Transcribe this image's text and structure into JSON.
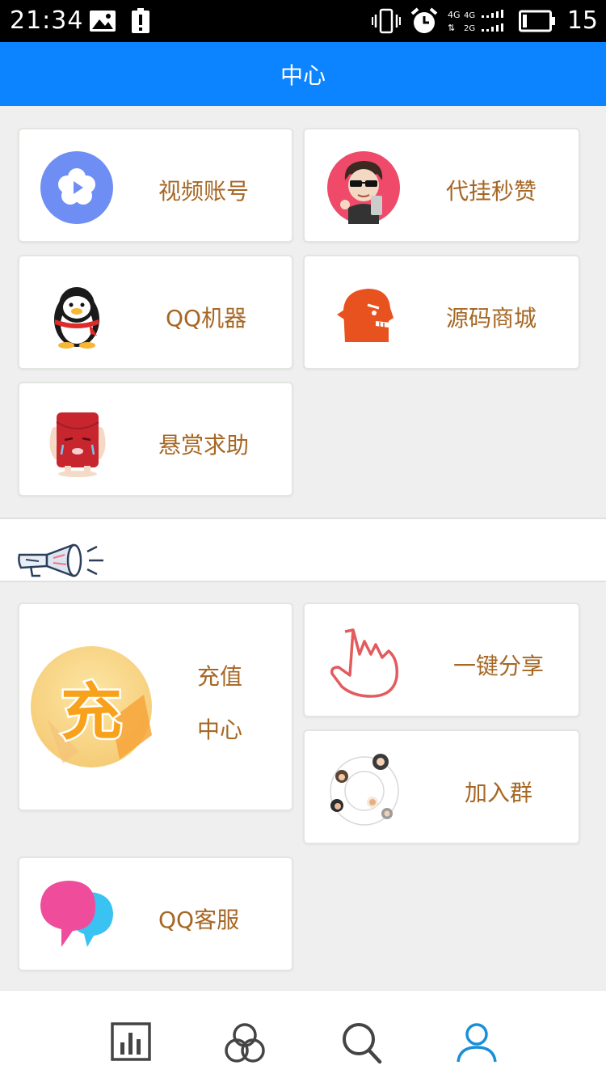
{
  "status_bar": {
    "time": "21:34",
    "network": "4G 4G 2G",
    "battery": "15"
  },
  "header": {
    "title": "中心"
  },
  "section1": {
    "items": [
      {
        "label": "视频账号",
        "icon": "video-flower-icon"
      },
      {
        "label": "代挂秒赞",
        "icon": "cartoon-boy-avatar-icon"
      },
      {
        "label": "QQ机器",
        "icon": "qq-penguin-icon"
      },
      {
        "label": "源码商城",
        "icon": "orange-bird-icon"
      },
      {
        "label": "悬赏求助",
        "icon": "red-envelope-crying-icon"
      }
    ]
  },
  "notice": {
    "icon": "megaphone-icon"
  },
  "section2": {
    "recharge": {
      "line1": "充值",
      "line2": "中心",
      "badge": "充",
      "icon": "recharge-icon"
    },
    "share": {
      "label": "一键分享",
      "icon": "pointing-hand-icon"
    },
    "join": {
      "label": "加入群",
      "icon": "group-orbit-icon"
    },
    "service": {
      "label": "QQ客服",
      "icon": "chat-bubbles-icon"
    }
  },
  "bottom_nav": {
    "items": [
      {
        "name": "stats",
        "icon": "bar-chart-icon"
      },
      {
        "name": "community",
        "icon": "circles-icon"
      },
      {
        "name": "search",
        "icon": "search-icon"
      },
      {
        "name": "profile",
        "icon": "user-icon",
        "active": true
      }
    ]
  },
  "colors": {
    "header": "#0d84ff",
    "label": "#a66724",
    "active": "#1a8fd8",
    "inactive": "#444444"
  }
}
